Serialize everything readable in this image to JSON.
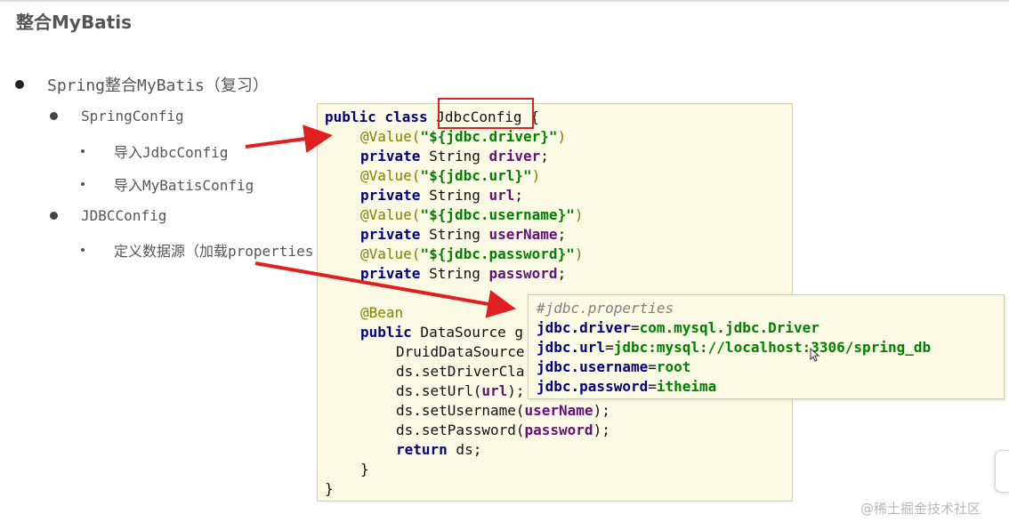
{
  "page": {
    "title": "整合MyBatis"
  },
  "bullets": {
    "l1": "Spring整合MyBatis（复习）",
    "spring_config": "SpringConfig",
    "import_jdbc": "导入JdbcConfig",
    "import_mybatis": "导入MyBatisConfig",
    "jdbc_config": "JDBCConfig",
    "define_ds": "定义数据源（加载properties"
  },
  "code": {
    "kw_public_class": "public class",
    "class_name": "JdbcConfig",
    "brace_open": " {",
    "ann_value": "@Value(",
    "str_driver": "\"${jdbc.driver}\"",
    "str_url": "\"${jdbc.url}\"",
    "str_username": "\"${jdbc.username}\"",
    "str_password": "\"${jdbc.password}\"",
    "paren_close": ")",
    "kw_private": "private",
    "type_string": " String ",
    "f_driver": "driver",
    "f_url": "url",
    "f_username": "userName",
    "f_password": "password",
    "semi": ";",
    "ann_bean": "@Bean",
    "kw_public": "public",
    "ds_sig": " DataSource g",
    "druid_line": "DruidDataSource",
    "set_driver": "ds.setDriverCla",
    "set_url_pre": "ds.setUrl(",
    "set_url_post": ");",
    "set_user_pre": "ds.setUsername(",
    "set_user_post": ");",
    "set_pass_pre": "ds.setPassword(",
    "set_pass_post": ");",
    "kw_return": "return",
    "return_rest": " ds;",
    "close_inner": "}",
    "close_outer": "}"
  },
  "properties": {
    "comment": "#jdbc.properties",
    "rows": [
      {
        "key": "jdbc.driver",
        "eq": "=",
        "value": "com.mysql.jdbc.Driver"
      },
      {
        "key": "jdbc.url",
        "eq": "=",
        "value": "jdbc:mysql://localhost:3306/spring_db"
      },
      {
        "key": "jdbc.username",
        "eq": "=",
        "value": "root"
      },
      {
        "key": "jdbc.password",
        "eq": "=",
        "value": "itheima"
      }
    ]
  },
  "annotations": {
    "highlight_color": "#e02020",
    "arrow_color": "#e02020"
  },
  "watermark": "@稀土掘金技术社区"
}
